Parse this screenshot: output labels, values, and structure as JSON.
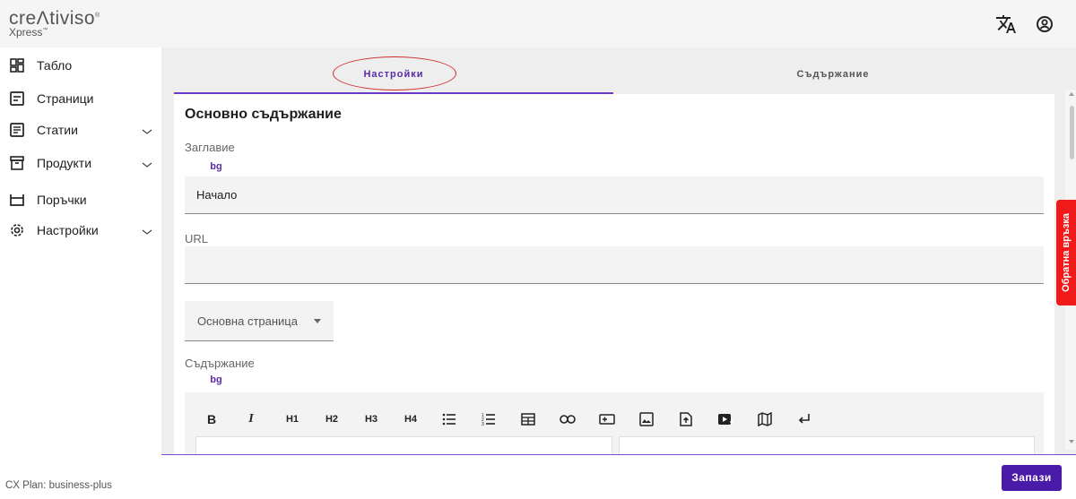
{
  "brand": {
    "logo_main": "creΛtiviso",
    "logo_sub": "Xpress",
    "reg": "®",
    "tm": "™"
  },
  "header": {
    "translate_icon": "translate-icon",
    "account_icon": "account-icon"
  },
  "sidebar": {
    "items": [
      {
        "label": "Табло",
        "icon": "dashboard-icon"
      },
      {
        "label": "Страници",
        "icon": "page-icon"
      },
      {
        "label": "Статии",
        "icon": "article-icon",
        "expandable": true
      },
      {
        "label": "Продукти",
        "icon": "archive-icon",
        "expandable": true
      },
      {
        "label": "Поръчки",
        "icon": "basket-icon"
      },
      {
        "label": "Настройки",
        "icon": "settings-icon",
        "expandable": true
      }
    ],
    "plan": "CX Plan: business-plus"
  },
  "tabs": [
    {
      "label": "Настройки",
      "active": true
    },
    {
      "label": "Съдържание",
      "active": false
    }
  ],
  "card": {
    "title": "Основно съдържание",
    "title_label": "Заглавие",
    "lang": "bg",
    "title_value": "Начало",
    "url_label": "URL",
    "url_value": "",
    "parent_select": "Основна страница",
    "content_label": "Съдържание",
    "content_lang": "bg"
  },
  "toolbar": {
    "buttons": [
      "B",
      "I",
      "H1",
      "H2",
      "H3",
      "H4"
    ]
  },
  "feedback": "Обратна връзка",
  "save_label": "Запази",
  "colors": {
    "accent": "#6a3cc6",
    "save": "#4a1aa8",
    "feedback": "#ef1b1b",
    "annotation": "#d22b2b"
  }
}
